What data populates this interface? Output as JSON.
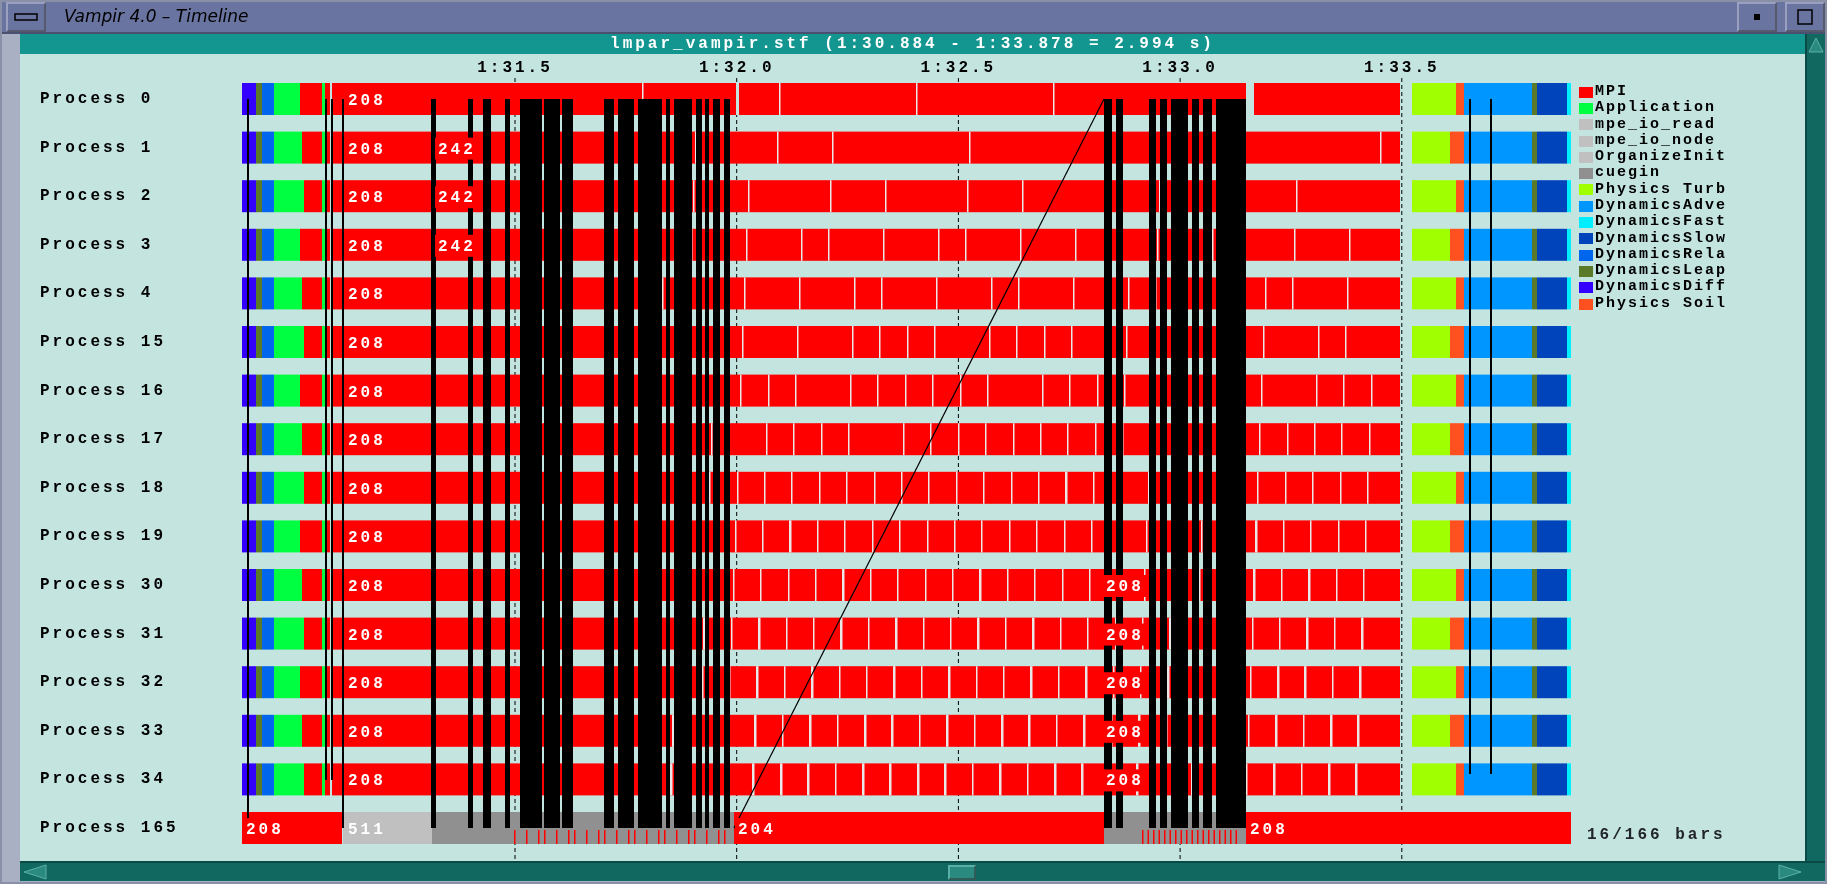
{
  "window": {
    "title": "Vampir 4.0 – Timeline"
  },
  "header": {
    "title": "lmpar_vampir.stf (1:30.884 - 1:33.878 = 2.994 s)"
  },
  "time_axis": {
    "ticks": [
      "1:31.5",
      "1:32.0",
      "1:32.5",
      "1:33.0",
      "1:33.5"
    ]
  },
  "rows": [
    {
      "name": "Process 0",
      "kind": "process",
      "labels": [
        {
          "text": "208",
          "kind": "start"
        }
      ]
    },
    {
      "name": "Process 1",
      "kind": "process",
      "labels": [
        {
          "text": "208",
          "kind": "start"
        },
        {
          "text": "242",
          "kind": "mid"
        }
      ]
    },
    {
      "name": "Process 2",
      "kind": "process",
      "labels": [
        {
          "text": "208",
          "kind": "start"
        },
        {
          "text": "242",
          "kind": "mid"
        }
      ]
    },
    {
      "name": "Process 3",
      "kind": "process",
      "labels": [
        {
          "text": "208",
          "kind": "start"
        },
        {
          "text": "242",
          "kind": "mid"
        }
      ]
    },
    {
      "name": "Process 4",
      "kind": "process",
      "labels": [
        {
          "text": "208",
          "kind": "start"
        }
      ]
    },
    {
      "name": "Process 15",
      "kind": "process",
      "labels": [
        {
          "text": "208",
          "kind": "start"
        }
      ]
    },
    {
      "name": "Process 16",
      "kind": "process",
      "labels": [
        {
          "text": "208",
          "kind": "start"
        }
      ]
    },
    {
      "name": "Process 17",
      "kind": "process",
      "labels": [
        {
          "text": "208",
          "kind": "start"
        }
      ]
    },
    {
      "name": "Process 18",
      "kind": "process",
      "labels": [
        {
          "text": "208",
          "kind": "start"
        }
      ]
    },
    {
      "name": "Process 19",
      "kind": "process",
      "labels": [
        {
          "text": "208",
          "kind": "start"
        }
      ]
    },
    {
      "name": "Process 30",
      "kind": "process",
      "labels": [
        {
          "text": "208",
          "kind": "start"
        },
        {
          "text": "208",
          "kind": "late"
        }
      ]
    },
    {
      "name": "Process 31",
      "kind": "process",
      "labels": [
        {
          "text": "208",
          "kind": "start"
        },
        {
          "text": "208",
          "kind": "late"
        }
      ]
    },
    {
      "name": "Process 32",
      "kind": "process",
      "labels": [
        {
          "text": "208",
          "kind": "start"
        },
        {
          "text": "208",
          "kind": "late"
        }
      ]
    },
    {
      "name": "Process 33",
      "kind": "process",
      "labels": [
        {
          "text": "208",
          "kind": "start"
        },
        {
          "text": "208",
          "kind": "late"
        }
      ]
    },
    {
      "name": "Process 34",
      "kind": "process",
      "labels": [
        {
          "text": "208",
          "kind": "start"
        },
        {
          "text": "208",
          "kind": "late"
        }
      ]
    },
    {
      "name": "Process 165",
      "kind": "summary",
      "labels": [
        {
          "text": "208",
          "kind": "start"
        },
        {
          "text": "511",
          "kind": "io"
        },
        {
          "text": "204",
          "kind": "resume"
        },
        {
          "text": "208",
          "kind": "end"
        }
      ]
    }
  ],
  "legend": [
    {
      "label": "MPI",
      "color": "#ff0000"
    },
    {
      "label": "Application",
      "color": "#00ff40"
    },
    {
      "label": "mpe_io_read",
      "color": "#c0c0c0"
    },
    {
      "label": "mpe_io_node",
      "color": "#c0c0c0"
    },
    {
      "label": "OrganizeInit",
      "color": "#c0c0c0"
    },
    {
      "label": "cuegin",
      "color": "#909090"
    },
    {
      "label": "Physics Turb",
      "color": "#a0ff00"
    },
    {
      "label": "DynamicsAdve",
      "color": "#0096ff"
    },
    {
      "label": "DynamicsFast",
      "color": "#00eeff"
    },
    {
      "label": "DynamicsSlow",
      "color": "#0044bb"
    },
    {
      "label": "DynamicsRela",
      "color": "#0066ee"
    },
    {
      "label": "DynamicsLeap",
      "color": "#5a7a2a"
    },
    {
      "label": "DynamicsDiff",
      "color": "#3300ff"
    },
    {
      "label": "Physics Soil",
      "color": "#ff5020"
    }
  ],
  "status": {
    "bar_count": "16/166 bars"
  }
}
